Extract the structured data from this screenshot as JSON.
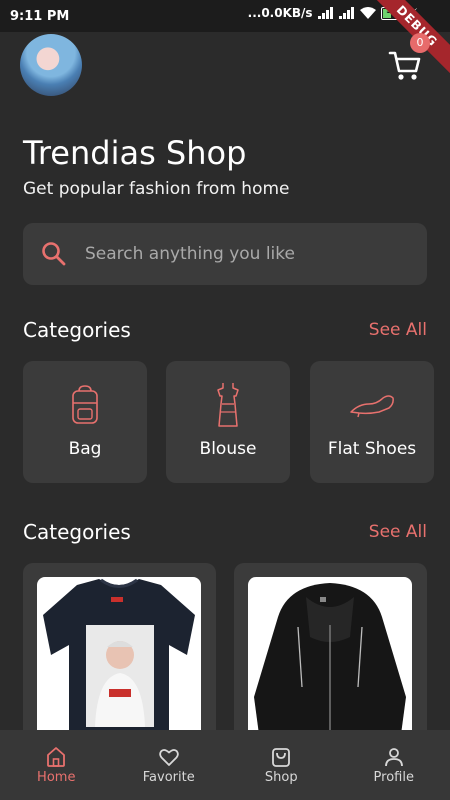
{
  "status_bar": {
    "time": "9:11 PM",
    "network_speed": "...0.0KB/s",
    "battery_level": "38",
    "debug_label": "DEBUG"
  },
  "header": {
    "cart_badge": "0",
    "title": "Trendias Shop",
    "subtitle": "Get popular fashion from home"
  },
  "search": {
    "placeholder": "Search anything you like"
  },
  "categories_section": {
    "title": "Categories",
    "see_all": "See All",
    "items": [
      {
        "label": "Bag",
        "icon": "bag-icon"
      },
      {
        "label": "Blouse",
        "icon": "blouse-icon"
      },
      {
        "label": "Flat Shoes",
        "icon": "flat-shoes-icon"
      }
    ]
  },
  "products_section": {
    "title": "Categories",
    "see_all": "See All",
    "items": [
      {
        "name": "t-shirt-product"
      },
      {
        "name": "jacket-product"
      }
    ]
  },
  "bottom_nav": {
    "items": [
      {
        "label": "Home",
        "icon": "home-icon",
        "active": true
      },
      {
        "label": "Favorite",
        "icon": "heart-icon",
        "active": false
      },
      {
        "label": "Shop",
        "icon": "shopping-bag-icon",
        "active": false
      },
      {
        "label": "Profile",
        "icon": "person-icon",
        "active": false
      }
    ]
  },
  "colors": {
    "background": "#2b2b2b",
    "card": "#3b3b3b",
    "accent": "#e8716e",
    "nav_background": "#373737"
  }
}
